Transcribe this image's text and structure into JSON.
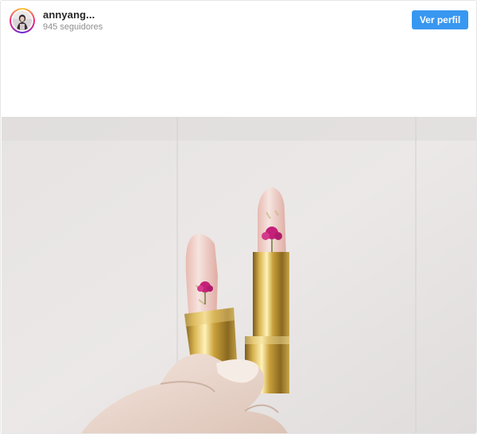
{
  "header": {
    "username": "annyang...",
    "followers": "945 seguidores",
    "view_profile_label": "Ver perfil"
  },
  "colors": {
    "accent": "#3897f0",
    "username_text": "#262626",
    "secondary_text": "#8e8e8e"
  },
  "post": {
    "image_subject": "lipstick-photo"
  }
}
